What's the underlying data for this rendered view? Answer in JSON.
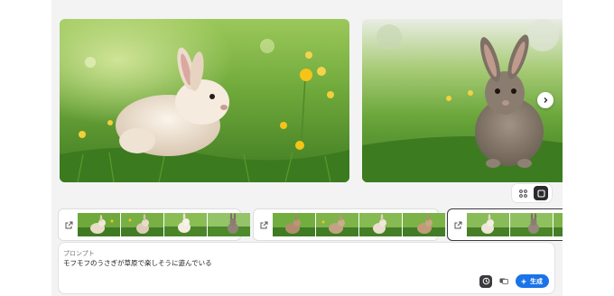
{
  "viewer": {
    "images": [
      {
        "subject": "rabbit-cream-dandelions"
      },
      {
        "subject": "rabbit-grey-grass"
      }
    ],
    "next_icon": "chevron-right-icon"
  },
  "view_switch": {
    "options": [
      "grid-view-icon",
      "single-view-icon"
    ],
    "selected": "single-view-icon"
  },
  "batches": [
    {
      "icon": "open-external-icon",
      "thumbs": [
        "rabbit-cream",
        "rabbit-cream",
        "rabbit-cream",
        "rabbit-grey"
      ]
    },
    {
      "icon": "open-external-icon",
      "thumbs": [
        "rabbit-brown",
        "rabbit-brown",
        "rabbit-cream",
        "rabbit-brown"
      ]
    },
    {
      "icon": "open-external-icon",
      "thumbs": [
        "rabbit-cream",
        "rabbit-grey",
        "rabbit-grey"
      ],
      "selected": true
    }
  ],
  "prompt": {
    "label": "プロンプト",
    "text": "モフモフのうさぎが草原で楽しそうに遊んでいる"
  },
  "actions": {
    "history_icon": "history-icon",
    "image_icon": "image-reference-icon",
    "generate_label": "生成",
    "generate_icon": "sparkle-icon"
  }
}
